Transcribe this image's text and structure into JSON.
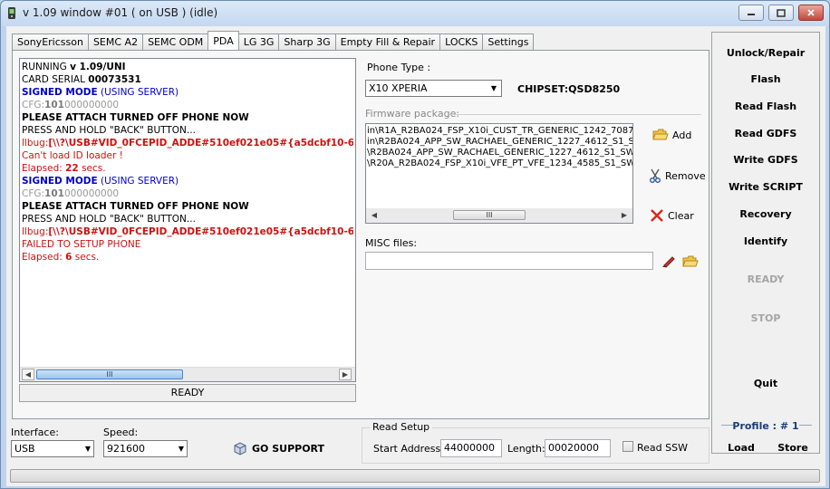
{
  "window": {
    "title": "v 1.09 window #01 ( on USB ) (idle)"
  },
  "tabs": [
    "SonyEricsson",
    "SEMC A2",
    "SEMC ODM",
    "PDA",
    "LG 3G",
    "Sharp 3G",
    "Empty Fill & Repair",
    "LOCKS",
    "Settings"
  ],
  "active_tab": "PDA",
  "log": {
    "lines": [
      {
        "parts": [
          {
            "t": "RUNNING "
          },
          {
            "t": "v 1.09/UNI",
            "b": true
          }
        ],
        "color": "black"
      },
      {
        "parts": [
          {
            "t": "CARD SERIAL "
          },
          {
            "t": "00073531",
            "b": true
          }
        ],
        "color": "black"
      },
      {
        "parts": [
          {
            "t": "SIGNED MODE",
            "b": true
          },
          {
            "t": " (USING SERVER)"
          }
        ],
        "color": "blue"
      },
      {
        "parts": [
          {
            "t": "CFG:"
          },
          {
            "t": "101",
            "b": true
          },
          {
            "t": "000000000"
          }
        ],
        "color": "gray"
      },
      {
        "parts": [
          {
            "t": "PLEASE ATTACH TURNED OFF PHONE NOW",
            "b": true
          }
        ],
        "color": "black"
      },
      {
        "parts": [
          {
            "t": "PRESS AND HOLD \"BACK\" BUTTON..."
          }
        ],
        "color": "black"
      },
      {
        "parts": [
          {
            "t": "llbug:"
          },
          {
            "t": "[\\\\?\\USB#VID_0FCEPID_ADDE#510ef021e05#{a5dcbf10-65",
            "b": true
          }
        ],
        "color": "red"
      },
      {
        "parts": [
          {
            "t": "Can't load ID loader !"
          }
        ],
        "color": "red"
      },
      {
        "parts": [
          {
            "t": "Elapsed: "
          },
          {
            "t": "22",
            "b": true
          },
          {
            "t": " secs."
          }
        ],
        "color": "red"
      },
      {
        "parts": [
          {
            "t": "SIGNED MODE",
            "b": true
          },
          {
            "t": " (USING SERVER)"
          }
        ],
        "color": "blue"
      },
      {
        "parts": [
          {
            "t": "CFG:"
          },
          {
            "t": "101",
            "b": true
          },
          {
            "t": "000000000"
          }
        ],
        "color": "gray"
      },
      {
        "parts": [
          {
            "t": "PLEASE ATTACH TURNED OFF PHONE NOW",
            "b": true
          }
        ],
        "color": "black"
      },
      {
        "parts": [
          {
            "t": "PRESS AND HOLD \"BACK\" BUTTON..."
          }
        ],
        "color": "black"
      },
      {
        "parts": [
          {
            "t": "llbug:"
          },
          {
            "t": "[\\\\?\\USB#VID_0FCEPID_ADDE#510ef021e05#{a5dcbf10-65",
            "b": true
          }
        ],
        "color": "red"
      },
      {
        "parts": [
          {
            "t": "FAILED TO SETUP PHONE"
          }
        ],
        "color": "red"
      },
      {
        "parts": [
          {
            "t": "Elapsed: "
          },
          {
            "t": "6",
            "b": true
          },
          {
            "t": " secs."
          }
        ],
        "color": "red"
      }
    ],
    "scroll_thumb_glyph": "III",
    "status": "READY"
  },
  "pda": {
    "phone_type_label": "Phone Type :",
    "phone_type_value": "X10 XPERIA",
    "chipset": "CHIPSET:QSD8250",
    "firmware_label": "Firmware package:",
    "firmware_items": [
      "in\\R1A_R2BA024_FSP_X10i_CUST_TR_GENERIC_1242_7087",
      "in\\R2BA024_APP_SW_RACHAEL_GENERIC_1227_4612_S1_S",
      "\\R2BA024_APP_SW_RACHAEL_GENERIC_1227_4612_S1_SW",
      "\\R20A_R2BA024_FSP_X10i_VFE_PT_VFE_1234_4585_S1_SW"
    ],
    "add_label": "Add",
    "remove_label": "Remove",
    "clear_label": "Clear",
    "misc_label": "MISC files:",
    "misc_value": ""
  },
  "side": {
    "buttons": [
      "Unlock/Repair",
      "Flash",
      "Read Flash",
      "Read GDFS",
      "Write GDFS",
      "Write SCRIPT",
      "Recovery",
      "Identify"
    ],
    "ready": "READY",
    "stop": "STOP",
    "quit": "Quit",
    "profile_label": "Profile :",
    "profile_value": "# 1",
    "load": "Load",
    "store": "Store"
  },
  "bottom": {
    "interface_label": "Interface:",
    "interface_value": "USB",
    "speed_label": "Speed:",
    "speed_value": "921600",
    "go_support": "GO SUPPORT",
    "read_setup_label": "Read Setup",
    "start_address_label": "Start Address:",
    "start_address_value": "44000000",
    "length_label": "Length:",
    "length_value": "00020000",
    "read_ssw_label": "Read SSW"
  }
}
